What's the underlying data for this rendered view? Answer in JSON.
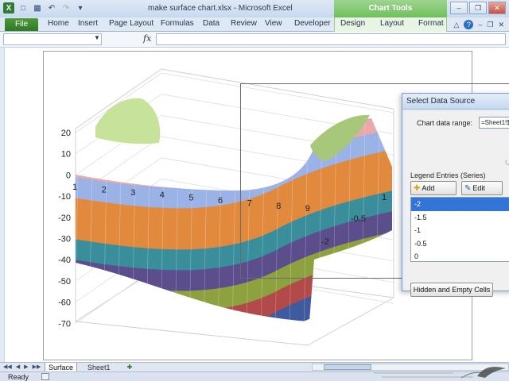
{
  "window": {
    "title": "make surface chart.xlsx - Microsoft Excel",
    "context_tab_group": "Chart Tools"
  },
  "ribbon": {
    "file_tab": "File",
    "tabs": [
      "Home",
      "Insert",
      "Page Layout",
      "Formulas",
      "Data",
      "Review",
      "View",
      "Developer"
    ],
    "chart_tabs": [
      "Design",
      "Layout",
      "Format"
    ],
    "accent_color": "#3f8f30"
  },
  "formula_bar": {
    "fx_label": "fx",
    "name_box_value": "",
    "formula_value": ""
  },
  "chart": {
    "y_axis_labels": [
      "20",
      "10",
      "0",
      "-10",
      "-20",
      "-30",
      "-40",
      "-50",
      "-60",
      "-70"
    ],
    "x_axis_labels": [
      "1",
      "2",
      "3",
      "4",
      "5",
      "6",
      "7",
      "8",
      "9"
    ],
    "depth_axis_labels": [
      "1",
      "-0.5",
      "-2"
    ],
    "band_colors": [
      "#c7e39a",
      "#e8a9a9",
      "#9bb2e6",
      "#e18a3e",
      "#3a8e9c",
      "#5c4d8c",
      "#8ea13f",
      "#b24a4a",
      "#3f5a9e"
    ]
  },
  "dialog": {
    "title": "Select Data Source",
    "chart_data_range_label": "Chart data range:",
    "chart_data_range_value": "=Sheet1!$",
    "legend_entries_label": "Legend Entries (Series)",
    "add_button": "Add",
    "edit_button": "Edit",
    "series": [
      "-2",
      "-1.5",
      "-1",
      "-0.5",
      "0"
    ],
    "selected_series": "-2",
    "hidden_empty_button": "Hidden and Empty Cells"
  },
  "sheet_tabs": {
    "tabs": [
      "Surface",
      "Sheet1"
    ],
    "active": "Surface"
  },
  "status": {
    "ready": "Ready"
  }
}
